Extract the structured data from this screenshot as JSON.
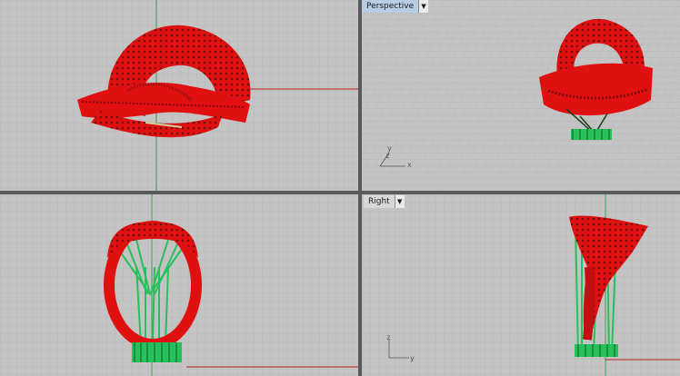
{
  "viewports": {
    "perspective": {
      "title": "Perspective",
      "axis_a": "y",
      "axis_b": "z",
      "axis_c": "x"
    },
    "right": {
      "title": "Right",
      "axis_a": "z",
      "axis_b": "y"
    }
  },
  "icons": {
    "dropdown": "chevron-down-icon"
  },
  "colors": {
    "model": "#e01010",
    "support": "#27c05a",
    "grid_bg": "#c4c4c4",
    "x_axis": "#c02020",
    "y_axis": "#20a040"
  }
}
